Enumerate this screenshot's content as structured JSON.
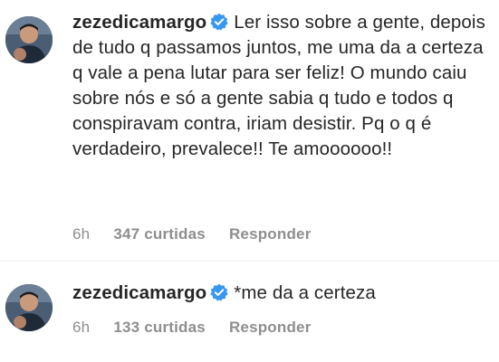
{
  "colors": {
    "text": "#262626",
    "meta": "#8e8e8e",
    "verified_badge": "#3897f0"
  },
  "comments": [
    {
      "username": "zezedicamargo",
      "verified_icon": "verified-badge-icon",
      "text": "Ler isso sobre a gente, depois de tudo q passamos juntos, me uma da a certeza q vale a pena lutar para ser feliz! O mundo caiu sobre nós e só a gente sabia q tudo e todos q conspiravam contra, iriam desistir. Pq o q é verdadeiro, prevalece!! Te amoooooo!!",
      "time": "6h",
      "likes": "347 curtidas",
      "reply": "Responder"
    },
    {
      "username": "zezedicamargo",
      "verified_icon": "verified-badge-icon",
      "text": "*me da a certeza",
      "time": "6h",
      "likes": "133 curtidas",
      "reply": "Responder"
    }
  ]
}
